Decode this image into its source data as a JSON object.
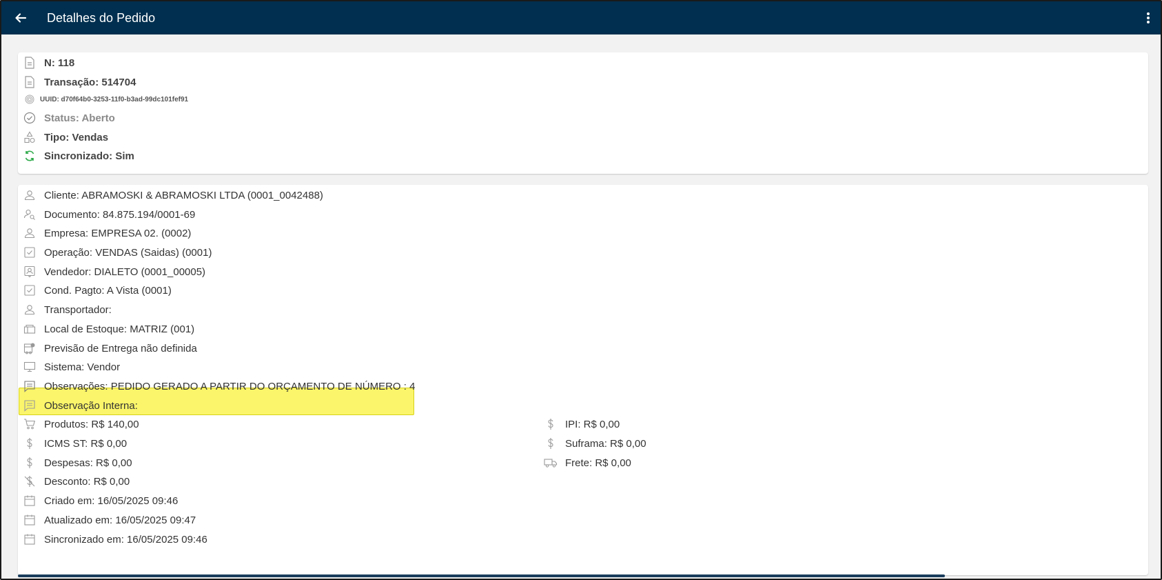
{
  "appbar": {
    "title": "Detalhes do Pedido",
    "back_icon": "arrow-left-icon",
    "menu_icon": "more-vertical-icon",
    "background": "#002f4f"
  },
  "header_card": {
    "numero": "N: 118",
    "transacao": "Transação: 514704",
    "uuid": "UUID: d70f64b0-3253-11f0-b3ad-99dc101fef91",
    "status": "Status: Aberto",
    "tipo": "Tipo: Vendas",
    "sincronizado": "Sincronizado: Sim",
    "sync_color": "#2eaa4a"
  },
  "details": {
    "cliente": "Cliente: ABRAMOSKI & ABRAMOSKI LTDA (0001_0042488)",
    "documento": "Documento: 84.875.194/0001-69",
    "empresa": "Empresa: EMPRESA 02. (0002)",
    "operacao": "Operação: VENDAS (Saidas) (0001)",
    "vendedor": "Vendedor: DIALETO (0001_00005)",
    "cond_pagto": "Cond. Pagto: A Vista (0001)",
    "transportador": "Transportador:",
    "local_estoque": "Local de Estoque: MATRIZ (001)",
    "previsao_entrega": "Previsão de Entrega não definida",
    "sistema": "Sistema: Vendor",
    "observacoes": "Observações: PEDIDO GERADO A PARTIR DO ORÇAMENTO DE NÚMERO : 4",
    "observacao_interna": "Observação Interna:",
    "produtos": "Produtos: R$ 140,00",
    "ipi": "IPI: R$ 0,00",
    "icms_st": "ICMS ST: R$ 0,00",
    "suframa": "Suframa: R$ 0,00",
    "despesas": "Despesas: R$ 0,00",
    "frete": "Frete: R$ 0,00",
    "desconto": "Desconto: R$ 0,00",
    "criado_em": "Criado em: 16/05/2025 09:46",
    "atualizado_em": "Atualizado em: 16/05/2025 09:47",
    "sincronizado_em": "Sincronizado em: 16/05/2025 09:46",
    "highlight_color": "#faf56a"
  }
}
